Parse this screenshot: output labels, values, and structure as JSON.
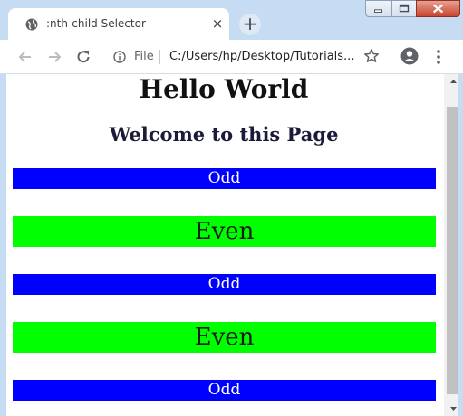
{
  "window": {
    "tab_title": ":nth-child Selector",
    "tab_close": "×",
    "new_tab": "+"
  },
  "toolbar": {
    "info_label": "File",
    "url": "C:/Users/hp/Desktop/Tutorials..."
  },
  "icons": {
    "back": "arrow-left-icon",
    "forward": "arrow-right-icon",
    "reload": "reload-icon",
    "info": "info-icon",
    "star": "star-icon",
    "profile": "avatar-icon",
    "menu": "three-dots-icon"
  },
  "page": {
    "heading": "Hello World",
    "subheading": "Welcome to this Page",
    "rows": [
      {
        "label": "Odd",
        "kind": "odd",
        "color": "#0000ff"
      },
      {
        "label": "Even",
        "kind": "even",
        "color": "#00ff00"
      },
      {
        "label": "Odd",
        "kind": "odd",
        "color": "#0000ff"
      },
      {
        "label": "Even",
        "kind": "even",
        "color": "#00ff00"
      },
      {
        "label": "Odd",
        "kind": "odd",
        "color": "#0000ff"
      }
    ]
  },
  "colors": {
    "frame": "#c5dcf2",
    "odd_bg": "#0000ff",
    "even_bg": "#00ff00"
  }
}
